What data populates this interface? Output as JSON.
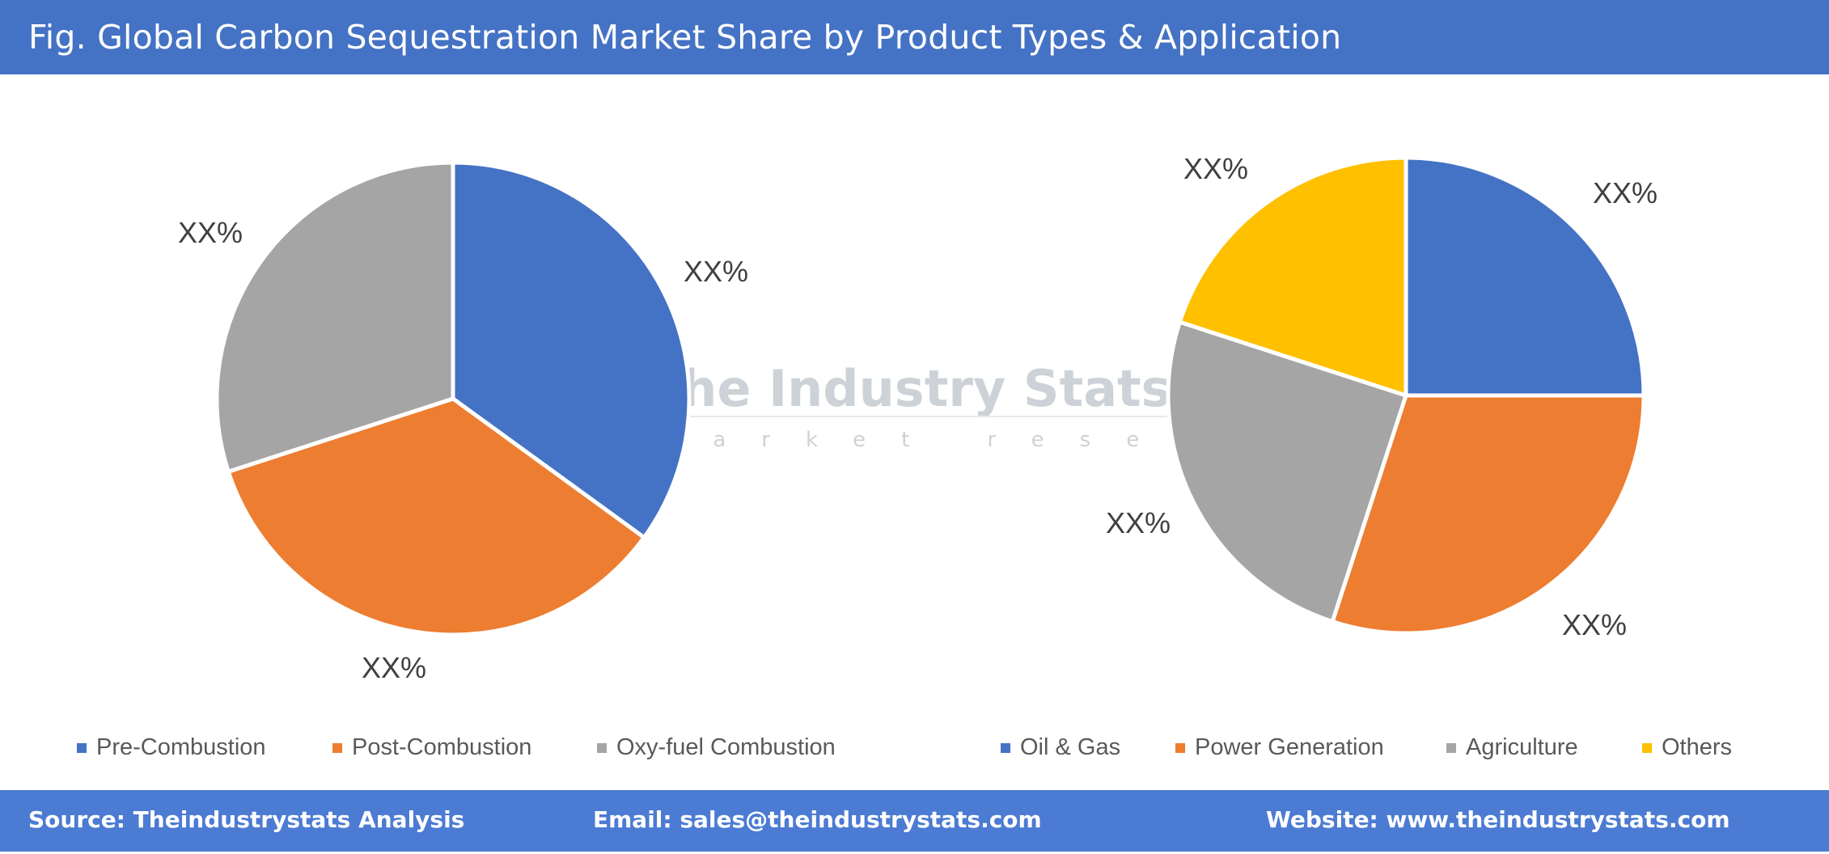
{
  "header": {
    "title": "Fig. Global Carbon Sequestration Market Share by Product Types & Application"
  },
  "watermark": {
    "name": "The Industry Stats",
    "tagline": "market research"
  },
  "chart_data": [
    {
      "type": "pie",
      "title": "Product Types",
      "categories": [
        "Pre-Combustion",
        "Post-Combustion",
        "Oxy-fuel Combustion"
      ],
      "values": [
        35,
        35,
        30
      ],
      "data_labels": [
        "XX%",
        "XX%",
        "XX%"
      ],
      "colors": [
        "#4472C4",
        "#ED7D31",
        "#A5A5A5"
      ],
      "start_angle": "top, clockwise",
      "legend": "bottom"
    },
    {
      "type": "pie",
      "title": "Application",
      "categories": [
        "Oil & Gas",
        "Power Generation",
        "Agriculture",
        "Others"
      ],
      "values": [
        25,
        30,
        25,
        20
      ],
      "data_labels": [
        "XX%",
        "XX%",
        "XX%",
        "XX%"
      ],
      "colors": [
        "#4472C4",
        "#ED7D31",
        "#A5A5A5",
        "#FFC000"
      ],
      "start_angle": "top, clockwise",
      "legend": "bottom"
    }
  ],
  "footer": {
    "source": "Source: Theindustrystats Analysis",
    "email": "Email: sales@theindustrystats.com",
    "website": "Website: www.theindustrystats.com"
  }
}
